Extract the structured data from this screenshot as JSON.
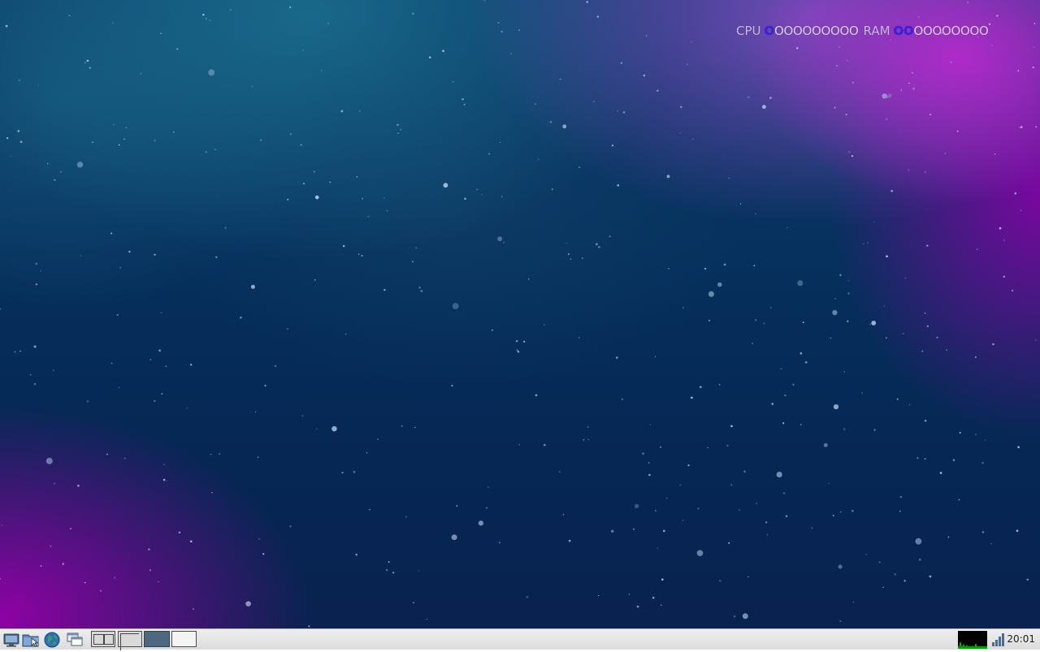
{
  "desktop": {
    "wallpaper": "space nebula",
    "colors": {
      "deep_blue": "#062f5c",
      "teal": "#1e7896",
      "purple": "#a020c8"
    }
  },
  "conky": {
    "cpu_label": "CPU",
    "cpu_filled": "O",
    "cpu_empty": "OOOOOOOOO",
    "cpu_fraction": 0.1,
    "ram_label": "RAM",
    "ram_filled": "OO",
    "ram_empty": "OOOOOOOO",
    "ram_fraction": 0.2,
    "fill_color": "#3622e6"
  },
  "taskbar": {
    "launchers": [
      {
        "name": "show-desktop-icon"
      },
      {
        "name": "file-manager-icon"
      },
      {
        "name": "web-browser-icon"
      },
      {
        "name": "window-list-icon"
      }
    ],
    "pager": {
      "workspaces": 4,
      "active": 3
    },
    "tray": {
      "icons": [
        "cpu-monitor-icon",
        "network-signal-icon"
      ]
    },
    "clock": "20:01"
  }
}
